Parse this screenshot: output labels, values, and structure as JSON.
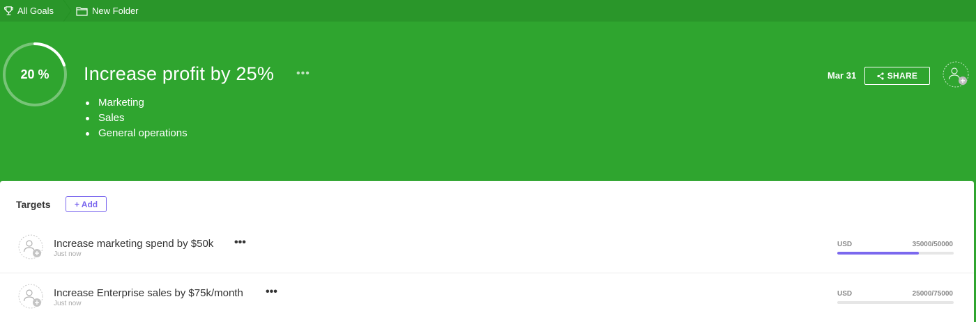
{
  "breadcrumb": {
    "items": [
      {
        "label": "All Goals",
        "icon": "trophy-icon"
      },
      {
        "label": "New Folder",
        "icon": "folder-icon"
      }
    ]
  },
  "goal": {
    "progress_label": "20 %",
    "progress": 0.2,
    "title": "Increase profit by 25%",
    "menu_icon": "ellipsis-icon",
    "description_items": [
      "Marketing",
      "Sales",
      "General operations"
    ],
    "due_date": "Mar 31",
    "share_label": "SHARE"
  },
  "targets": {
    "title": "Targets",
    "add_label": "+ Add",
    "items": [
      {
        "name": "Increase marketing spend by $50k",
        "meta": "Just now",
        "unit": "USD",
        "progress_text": "35000/50000",
        "current": 35000,
        "target": 50000
      },
      {
        "name": "Increase Enterprise sales by $75k/month",
        "meta": "Just now",
        "unit": "USD",
        "progress_text": "25000/75000",
        "current": 25000,
        "target": 75000
      }
    ]
  },
  "colors": {
    "header_green": "#2fa52f",
    "topbar_green": "#2a962a",
    "accent_purple": "#7b68ee"
  }
}
